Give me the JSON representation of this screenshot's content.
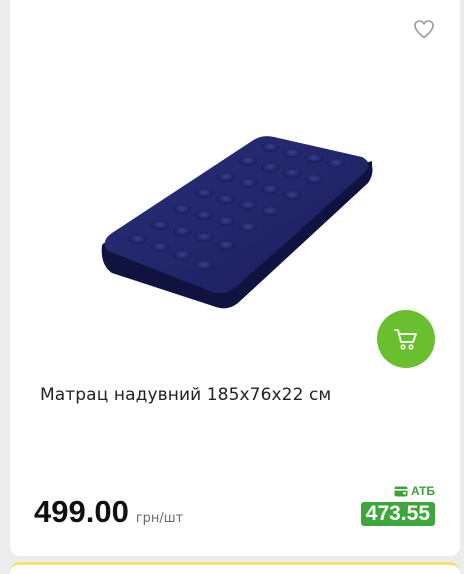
{
  "product": {
    "title": "Матрац надувний 185х76х22 см",
    "price": "499.00",
    "unit": "грн/шт",
    "card_label": "АТБ",
    "card_price": "473.55"
  },
  "icons": {
    "favorite": "heart-outline-icon",
    "cart": "cart-icon",
    "card": "wallet-card-icon"
  },
  "colors": {
    "accent_green": "#6abf2e",
    "card_price_green": "#3ea63a",
    "page_background": "#ececec"
  }
}
